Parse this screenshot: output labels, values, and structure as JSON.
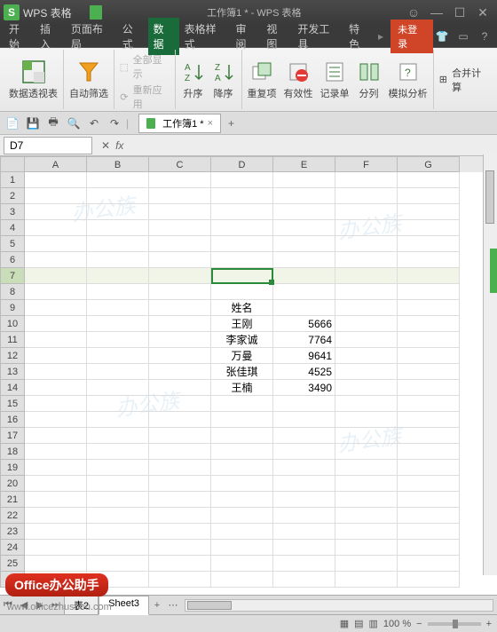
{
  "titlebar": {
    "app_name": "WPS 表格",
    "doc_title": "工作簿1 * - WPS 表格"
  },
  "menu": {
    "items": [
      "开始",
      "插入",
      "页面布局",
      "公式",
      "数据",
      "表格样式",
      "审阅",
      "视图",
      "开发工具",
      "特色"
    ],
    "active_index": 4,
    "login": "未登录"
  },
  "ribbon": {
    "pivot": "数据透视表",
    "filter": "自动筛选",
    "showall": "全部显示",
    "reapply": "重新应用",
    "asc": "升序",
    "desc": "降序",
    "dup": "重复项",
    "valid": "有效性",
    "form": "记录单",
    "split": "分列",
    "whatif": "模拟分析",
    "consolidate": "合并计算"
  },
  "qat": {
    "doc_tab": "工作簿1 *"
  },
  "namebox": {
    "ref": "D7",
    "fx": "fx"
  },
  "columns": [
    "A",
    "B",
    "C",
    "D",
    "E",
    "F",
    "G"
  ],
  "active": {
    "row": 7,
    "col": "D"
  },
  "rows": 26,
  "data": {
    "9": {
      "D": "姓名"
    },
    "10": {
      "D": "王刚",
      "E": "5666"
    },
    "11": {
      "D": "李家诚",
      "E": "7764"
    },
    "12": {
      "D": "万曼",
      "E": "9641"
    },
    "13": {
      "D": "张佳琪",
      "E": "4525"
    },
    "14": {
      "D": "王楠",
      "E": "3490"
    }
  },
  "sheets": {
    "tabs": [
      "表2",
      "Sheet3"
    ],
    "active": 1
  },
  "status": {
    "zoom": "100 %"
  },
  "branding": {
    "badge": "Office办公助手",
    "url": "www.officezhushou.com",
    "wm": "办公族"
  }
}
